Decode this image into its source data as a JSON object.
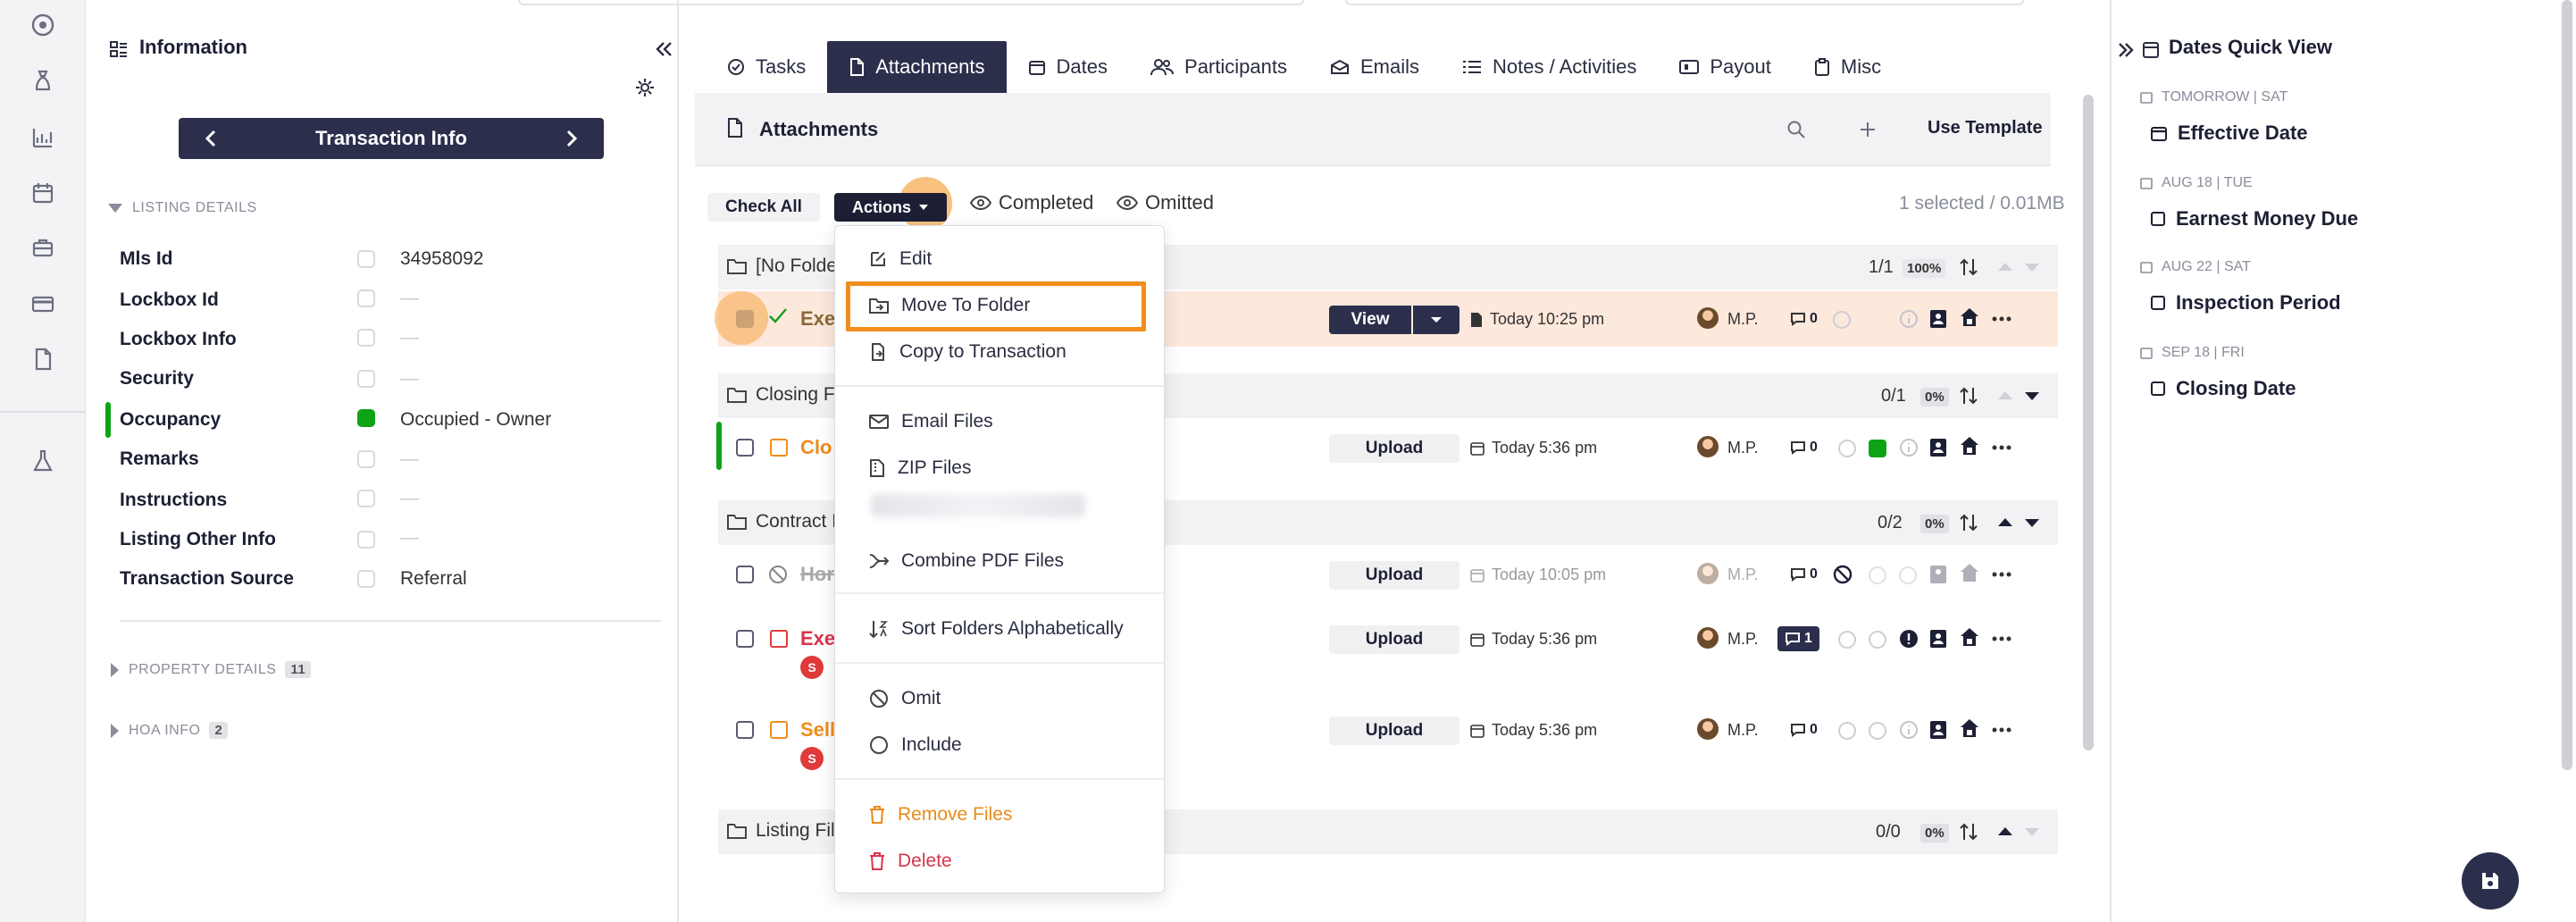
{
  "info_panel": {
    "title": "Information",
    "transaction_nav": "Transaction Info",
    "listing_details_label": "LISTING DETAILS",
    "rows": [
      {
        "label": "Mls Id",
        "value": "34958092"
      },
      {
        "label": "Lockbox Id",
        "value": "—"
      },
      {
        "label": "Lockbox Info",
        "value": "—"
      },
      {
        "label": "Security",
        "value": "—"
      },
      {
        "label": "Occupancy",
        "value": "Occupied - Owner"
      },
      {
        "label": "Remarks",
        "value": "—"
      },
      {
        "label": "Instructions",
        "value": "—"
      },
      {
        "label": "Listing Other Info",
        "value": "—"
      },
      {
        "label": "Transaction Source",
        "value": "Referral"
      }
    ],
    "property_details": {
      "label": "PROPERTY DETAILS",
      "count": "11"
    },
    "hoa_info": {
      "label": "HOA INFO",
      "count": "2"
    }
  },
  "tabs": [
    "Tasks",
    "Attachments",
    "Dates",
    "Participants",
    "Emails",
    "Notes / Activities",
    "Payout",
    "Misc"
  ],
  "attachments": {
    "title": "Attachments",
    "use_template": "Use Template",
    "check_all": "Check All",
    "actions": "Actions",
    "completed": "Completed",
    "omitted": "Omitted",
    "selected_info": "1 selected / 0.01MB",
    "folders": [
      {
        "name": "[No Folde",
        "count": "1/1",
        "pct": "100%"
      },
      {
        "name": "Closing Fi",
        "count": "0/1",
        "pct": "0%"
      },
      {
        "name": "Contract F",
        "count": "0/2",
        "pct": "0%"
      },
      {
        "name": "Listing File",
        "count": "0/0",
        "pct": "0%"
      }
    ],
    "files": [
      {
        "name": "Exe",
        "button": "View",
        "date": "Today 10:25 pm",
        "initials": "M.P.",
        "comments": "0"
      },
      {
        "name": "Clo",
        "button": "Upload",
        "date": "Today 5:36 pm",
        "initials": "M.P.",
        "comments": "0"
      },
      {
        "name": "Hor",
        "button": "Upload",
        "date": "Today 10:05 pm",
        "initials": "M.P.",
        "comments": "0"
      },
      {
        "name": "Exe",
        "button": "Upload",
        "date": "Today 5:36 pm",
        "initials": "M.P.",
        "comments": "1",
        "badge": "S"
      },
      {
        "name": "Sell",
        "button": "Upload",
        "date": "Today 5:36 pm",
        "initials": "M.P.",
        "comments": "0",
        "badge": "S"
      }
    ]
  },
  "menu": {
    "edit": "Edit",
    "move_to_folder": "Move To Folder",
    "copy_to_transaction": "Copy to Transaction",
    "email_files": "Email Files",
    "zip_files": "ZIP Files",
    "combine_pdf": "Combine PDF Files",
    "sort_folders": "Sort Folders Alphabetically",
    "omit": "Omit",
    "include": "Include",
    "remove_files": "Remove Files",
    "delete": "Delete"
  },
  "dates_quick_view": {
    "title": "Dates Quick View",
    "items": [
      {
        "caption": "TOMORROW | SAT",
        "label": "Effective Date"
      },
      {
        "caption": "AUG 18 | TUE",
        "label": "Earnest Money Due"
      },
      {
        "caption": "AUG 22 | SAT",
        "label": "Inspection Period"
      },
      {
        "caption": "SEP 18 | FRI",
        "label": "Closing Date"
      }
    ]
  },
  "colors": {
    "navy": "#2b2f4c",
    "accent_orange": "#f28c1b",
    "green": "#0ea317",
    "red": "#d9344a"
  }
}
